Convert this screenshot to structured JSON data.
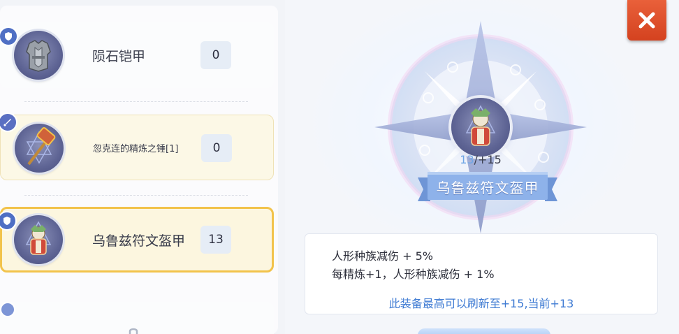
{
  "equipment_list": [
    {
      "name": "陨石铠甲",
      "count": "0",
      "badge_icon": "shield-icon",
      "style": "plain"
    },
    {
      "name": "忽克连的精炼之锤[1]",
      "count": "0",
      "badge_icon": "sword-icon",
      "style": "yellow"
    },
    {
      "name": "乌鲁兹符文盔甲",
      "count": "13",
      "badge_icon": "shield-icon",
      "style": "selected"
    }
  ],
  "detail": {
    "level_current": "13",
    "level_max": "/+15",
    "name": "乌鲁兹符文盔甲",
    "effect_line_1": "人形种族减伤 + 5%",
    "effect_line_2": "每精炼+1，人形种族减伤 + 1%",
    "refresh_note": "此装备最高可以刷新至+15,当前+13"
  },
  "close_icon": "close-icon",
  "colors": {
    "accent_blue": "#3f7bd3",
    "selected_border": "#f2c34b",
    "close_red": "#d4421f",
    "ribbon_blue": "#7fa6e0"
  }
}
